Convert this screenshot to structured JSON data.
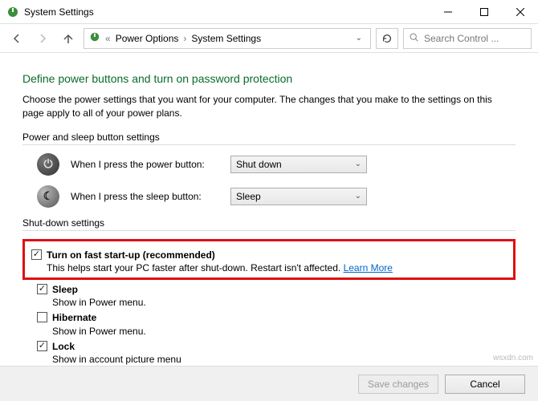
{
  "window": {
    "title": "System Settings"
  },
  "breadcrumb": {
    "root_icon": "power-plan-icon",
    "items": [
      "Power Options",
      "System Settings"
    ]
  },
  "search": {
    "placeholder": "Search Control ..."
  },
  "page": {
    "heading": "Define power buttons and turn on password protection",
    "description": "Choose the power settings that you want for your computer. The changes that you make to the settings on this page apply to all of your power plans."
  },
  "power_section": {
    "label": "Power and sleep button settings",
    "power_button": {
      "label": "When I press the power button:",
      "value": "Shut down"
    },
    "sleep_button": {
      "label": "When I press the sleep button:",
      "value": "Sleep"
    }
  },
  "shutdown_section": {
    "label": "Shut-down settings",
    "fast_startup": {
      "checked": true,
      "title": "Turn on fast start-up (recommended)",
      "desc": "This helps start your PC faster after shut-down. Restart isn't affected.",
      "link": "Learn More"
    },
    "sleep": {
      "checked": true,
      "title": "Sleep",
      "desc": "Show in Power menu."
    },
    "hibernate": {
      "checked": false,
      "title": "Hibernate",
      "desc": "Show in Power menu."
    },
    "lock": {
      "checked": true,
      "title": "Lock",
      "desc": "Show in account picture menu"
    }
  },
  "footer": {
    "save": "Save changes",
    "cancel": "Cancel"
  },
  "watermark": "wsxdn.com"
}
